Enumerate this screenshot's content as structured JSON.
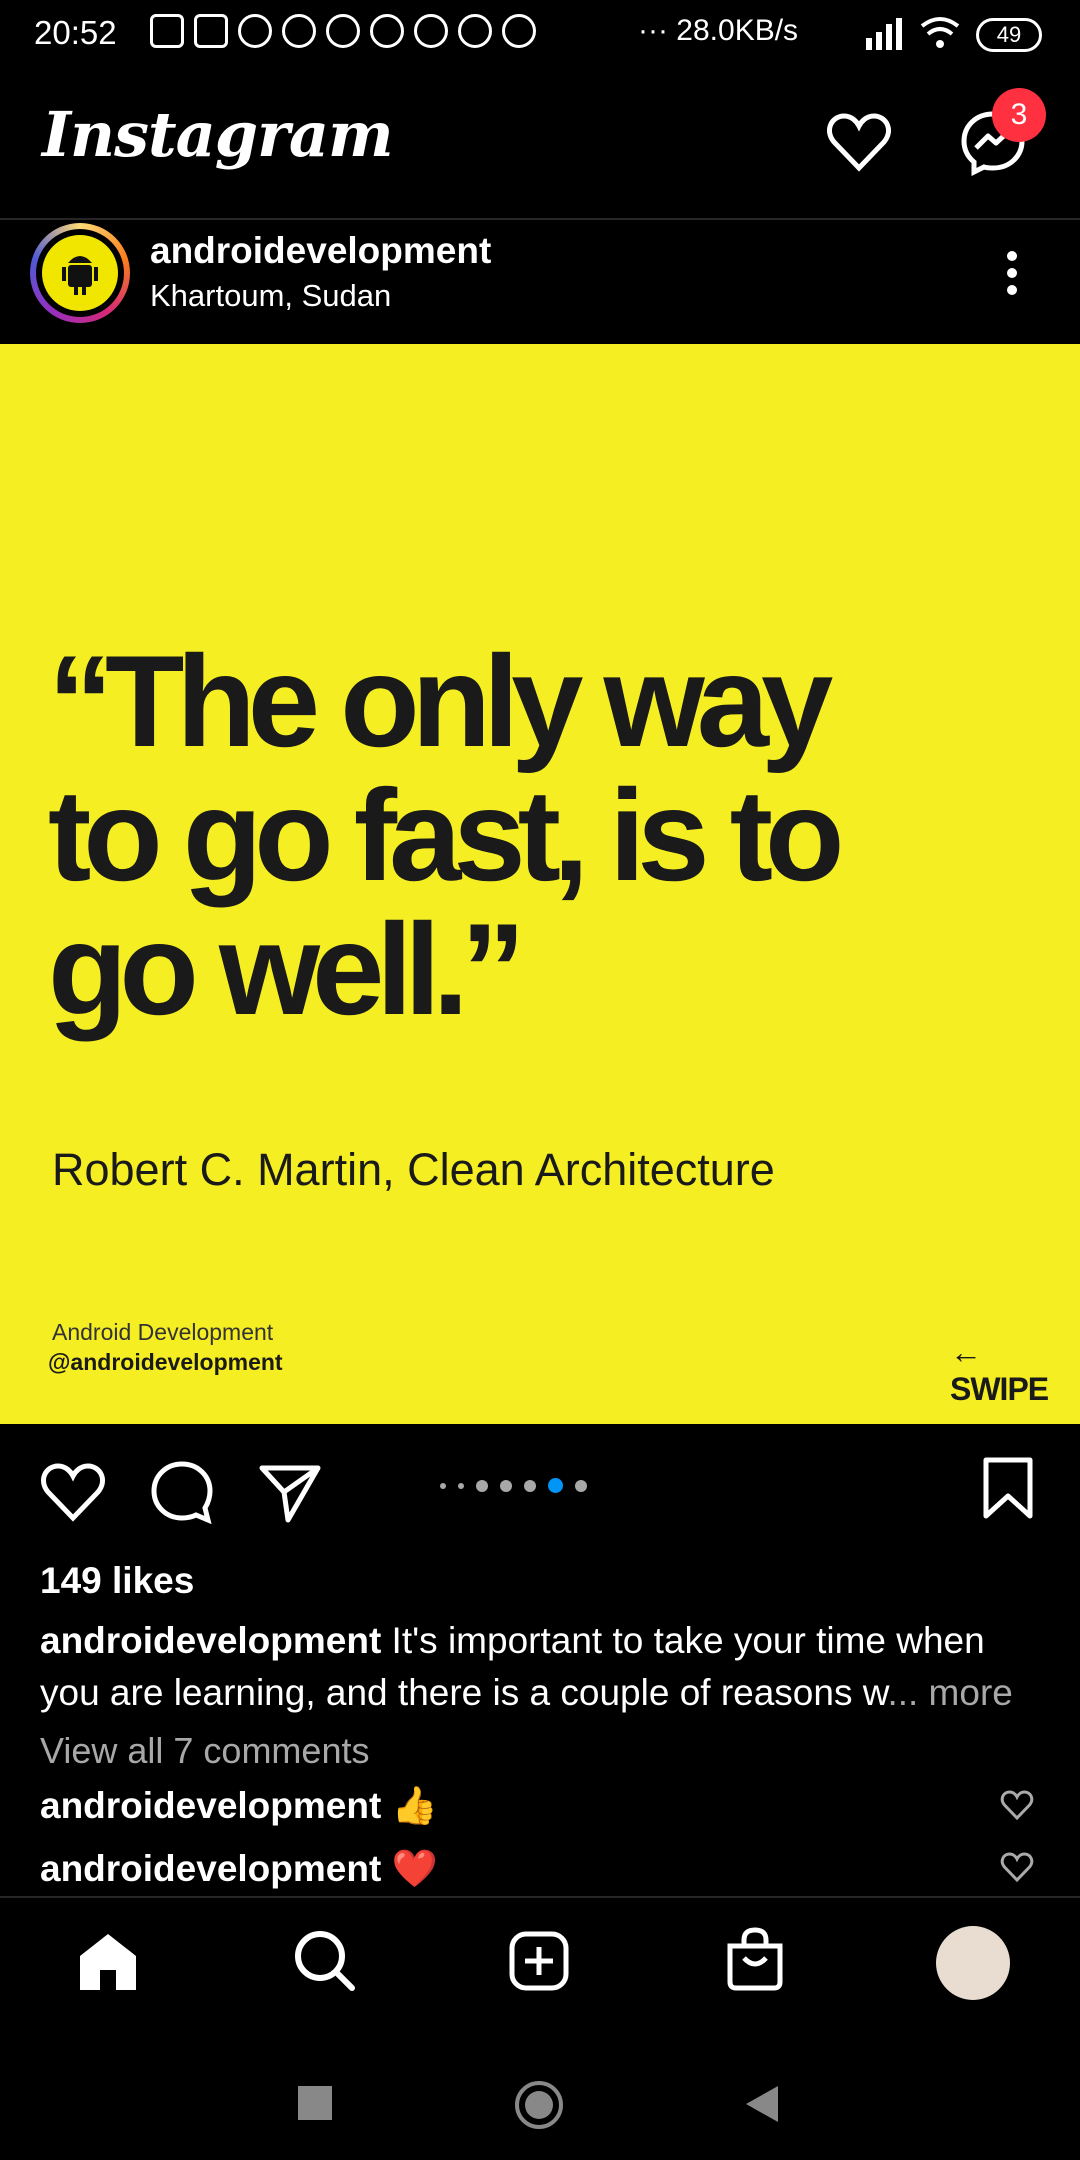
{
  "status": {
    "time": "20:52",
    "speed": "··· 28.0KB/s",
    "battery": "49"
  },
  "header": {
    "logo": "Instagram",
    "messages_badge": "3"
  },
  "post": {
    "username": "androidevelopment",
    "location": "Khartoum, Sudan",
    "image": {
      "quote_line1": "“The only way",
      "quote_line2": "to go fast, is to",
      "quote_line3": "go well.”",
      "author": "Robert C. Martin, Clean Architecture",
      "brand_name": "Android Development",
      "brand_handle": "@androidevelopment",
      "swipe": "SWIPE",
      "bg_color": "#f5ee22"
    },
    "likes": "149 likes",
    "caption_user": "androidevelopment",
    "caption_text": " It's important to take your time when you are learning, and there is a couple of reasons w",
    "caption_more": "... more",
    "view_all": "View all 7 comments",
    "comments": [
      {
        "user": "androidevelopment",
        "emoji": "👍"
      },
      {
        "user": "androidevelopment",
        "emoji": "❤️"
      }
    ]
  },
  "colors": {
    "accent": "#0095f6",
    "badge": "#ff3040"
  }
}
